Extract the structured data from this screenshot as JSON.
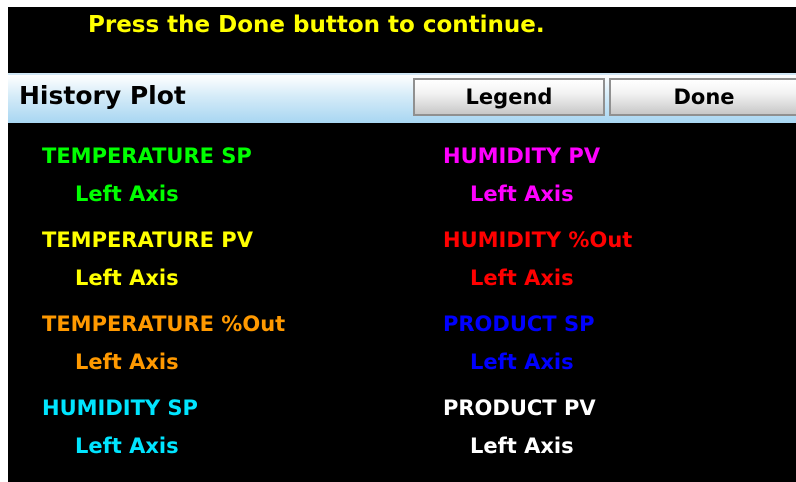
{
  "instruction": "Press the Done button to continue.",
  "header": {
    "title": "History Plot",
    "legend_label": "Legend",
    "done_label": "Done"
  },
  "legend": {
    "left": [
      {
        "name": "TEMPERATURE SP",
        "axis": "Left Axis",
        "color": "#00ff00"
      },
      {
        "name": "TEMPERATURE PV",
        "axis": "Left Axis",
        "color": "#ffff00"
      },
      {
        "name": "TEMPERATURE %Out",
        "axis": "Left Axis",
        "color": "#ff9900"
      },
      {
        "name": "HUMIDITY SP",
        "axis": "Left Axis",
        "color": "#00e5ff"
      }
    ],
    "right": [
      {
        "name": "HUMIDITY PV",
        "axis": "Left Axis",
        "color": "#ff00ff"
      },
      {
        "name": "HUMIDITY %Out",
        "axis": "Left Axis",
        "color": "#ff0000"
      },
      {
        "name": "PRODUCT SP",
        "axis": "Left Axis",
        "color": "#0000ff"
      },
      {
        "name": "PRODUCT PV",
        "axis": "Left Axis",
        "color": "#ffffff"
      }
    ]
  }
}
